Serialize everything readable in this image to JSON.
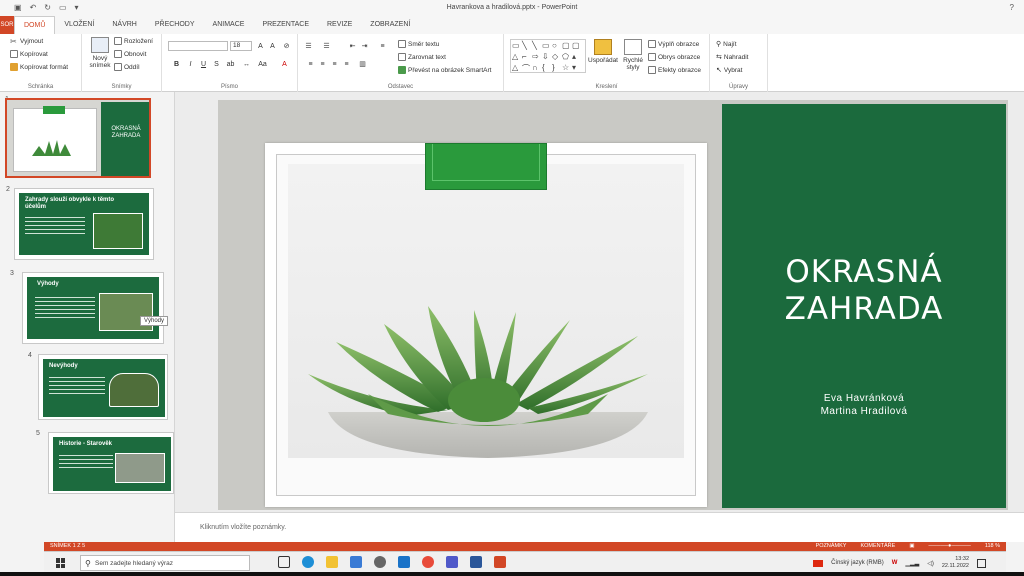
{
  "window": {
    "doc_title": "Havrankova a hradilová.pptx - PowerPoint",
    "help": "?"
  },
  "ribbon_tabs": {
    "file": "SOR",
    "items": [
      "DOMŮ",
      "VLOŽENÍ",
      "NÁVRH",
      "PŘECHODY",
      "ANIMACE",
      "PREZENTACE",
      "REVIZE",
      "ZOBRAZENÍ"
    ]
  },
  "ribbon": {
    "clipboard": {
      "cut": "Vyjmout",
      "copy": "Kopírovat",
      "format_painter": "Kopírovat formát",
      "label": "Schránka"
    },
    "slides": {
      "new_slide_1": "Nový",
      "new_slide_2": "snímek",
      "layout": "Rozložení",
      "reset": "Obnovit",
      "section": "Oddíl",
      "label": "Snímky"
    },
    "font": {
      "size": "18",
      "bold": "B",
      "italic": "I",
      "underline": "U",
      "strike": "S",
      "label": "Písmo"
    },
    "paragraph": {
      "text_direction": "Směr textu",
      "align_text": "Zarovnat text",
      "smartart": "Převést na obrázek SmartArt",
      "label": "Odstavec"
    },
    "drawing": {
      "arrange": "Uspořádat",
      "quick_styles_1": "Rychlé",
      "quick_styles_2": "styly",
      "shape_fill": "Výplň obrazce",
      "shape_outline": "Obrys obrazce",
      "shape_effects": "Efekty obrazce",
      "label": "Kreslení"
    },
    "editing": {
      "find": "Najít",
      "replace": "Nahradit",
      "select": "Vybrat",
      "label": "Úpravy"
    }
  },
  "thumbnails": [
    {
      "num": "1",
      "title": "OKRASNÁ ZAHRADA"
    },
    {
      "num": "2",
      "title": "Zahrady slouží obvykle k těmto účelům"
    },
    {
      "num": "3",
      "title": "Výhody",
      "tooltip": "Výhody"
    },
    {
      "num": "4",
      "title": "Nevýhody"
    },
    {
      "num": "5",
      "title": "Historie - Starověk"
    }
  ],
  "slide": {
    "title_line1": "OKRASNÁ",
    "title_line2": "ZAHRADA",
    "author1": "Eva Havránková",
    "author2": "Martina Hradilová",
    "panel_color": "#1b6a3d",
    "tab_color": "#2a9a3c"
  },
  "notes": {
    "placeholder": "Kliknutím vložíte poznámky."
  },
  "statusbar": {
    "slide_info": "SNÍMEK 1 Z 5",
    "notes_btn": "POZNÁMKY",
    "comments_btn": "KOMENTÁŘE",
    "zoom": "118 %",
    "accent": "#d24726"
  },
  "taskbar": {
    "search_placeholder": "Sem zadejte hledaný výraz",
    "ime": "Čínský jazyk (RMB)",
    "time": "13:32",
    "date": "22.11.2022"
  }
}
